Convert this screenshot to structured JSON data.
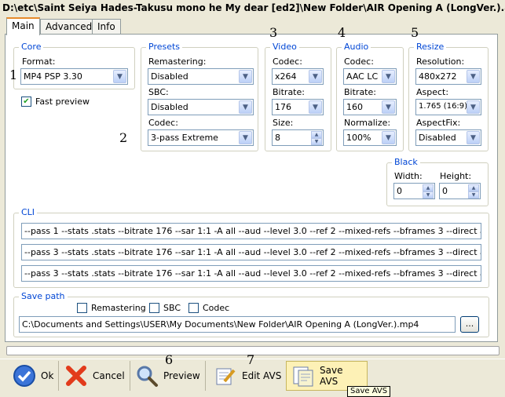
{
  "title": "D:\\etc\\Saint Seiya Hades-Takusu mono he My dear [ed2]\\New Folder\\AIR Opening A (LongVer.).avi",
  "tabs": [
    "Main",
    "Advanced",
    "Info"
  ],
  "annotations": [
    "1",
    "2",
    "3",
    "4",
    "5",
    "6",
    "7"
  ],
  "core": {
    "title": "Core",
    "format_label": "Format:",
    "format_value": "MP4 PSP 3.30",
    "fast_preview_label": "Fast preview",
    "fast_preview_checked": true
  },
  "presets": {
    "title": "Presets",
    "remastering_label": "Remastering:",
    "remastering_value": "Disabled",
    "sbc_label": "SBC:",
    "sbc_value": "Disabled",
    "codec_label": "Codec:",
    "codec_value": "3-pass Extreme"
  },
  "video": {
    "title": "Video",
    "codec_label": "Codec:",
    "codec_value": "x264",
    "bitrate_label": "Bitrate:",
    "bitrate_value": "176",
    "size_label": "Size:",
    "size_value": "8"
  },
  "audio": {
    "title": "Audio",
    "codec_label": "Codec:",
    "codec_value": "AAC LC",
    "bitrate_label": "Bitrate:",
    "bitrate_value": "160",
    "normalize_label": "Normalize:",
    "normalize_value": "100%"
  },
  "resize": {
    "title": "Resize",
    "resolution_label": "Resolution:",
    "resolution_value": "480x272",
    "aspect_label": "Aspect:",
    "aspect_value": "1.765 (16:9)",
    "aspectfix_label": "AspectFix:",
    "aspectfix_value": "Disabled"
  },
  "black": {
    "title": "Black",
    "width_label": "Width:",
    "width_value": "0",
    "height_label": "Height:",
    "height_value": "0"
  },
  "cli": {
    "title": "CLI",
    "lines": [
      "--pass 1 --stats .stats --bitrate 176 --sar 1:1 -A all --aud --level 3.0 --ref 2 --mixed-refs --bframes 3 --direct auto --analyse",
      "--pass 3 --stats .stats --bitrate 176 --sar 1:1 -A all --aud --level 3.0 --ref 2 --mixed-refs --bframes 3 --direct auto --analyse",
      "--pass 3 --stats .stats --bitrate 176 --sar 1:1 -A all --aud --level 3.0 --ref 2 --mixed-refs --bframes 3 --direct auto --analyse"
    ]
  },
  "save_path": {
    "title": "Save path",
    "remastering_label": "Remastering",
    "sbc_label": "SBC",
    "codec_label": "Codec",
    "path_value": "C:\\Documents and Settings\\USER\\My Documents\\New Folder\\AIR Opening A (LongVer.).mp4",
    "browse_label": "..."
  },
  "toolbar": {
    "ok_label": "Ok",
    "cancel_label": "Cancel",
    "preview_label": "Preview",
    "edit_avs_label": "Edit AVS",
    "save_avs_label": "Save AVS",
    "tooltip": "Save AVS"
  },
  "colors": {
    "accent": "#0046d5",
    "tab_highlight": "#e68b2c",
    "hover": "#fdf1b6"
  }
}
